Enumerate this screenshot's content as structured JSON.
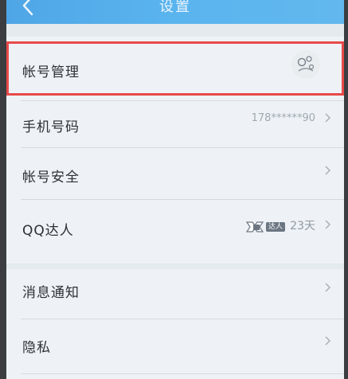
{
  "nav": {
    "title": "设置"
  },
  "groups": [
    {
      "items": [
        {
          "label": "帐号管理"
        },
        {
          "label": "手机号码",
          "value": "178******90"
        },
        {
          "label": "帐号安全"
        },
        {
          "label": "QQ达人",
          "badge_text": "达人",
          "value": "23天"
        }
      ]
    },
    {
      "items": [
        {
          "label": "消息通知"
        },
        {
          "label": "隐私"
        }
      ]
    }
  ],
  "colors": {
    "nav_bar": "#5ab4ee",
    "list_bg": "#eef2f6",
    "highlight": "#e84a4a",
    "label_text": "#2d3136",
    "value_text": "#9fa8b0"
  },
  "icons": {
    "back": "chevron-left-icon",
    "row_arrow": "chevron-right-icon",
    "avatar": "avatar-image",
    "badge": "qq-daren-badge-icon"
  }
}
